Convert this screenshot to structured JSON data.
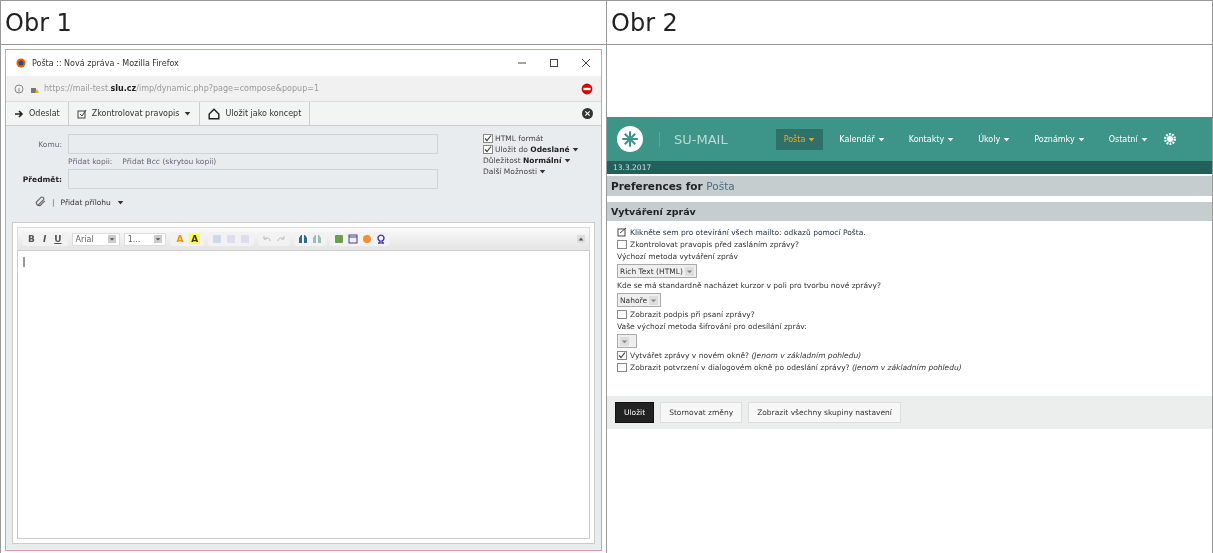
{
  "table": {
    "columns": [
      "Obr 1",
      "Obr 2"
    ]
  },
  "figure_1": {
    "window": {
      "title": "Pošta :: Nová zpráva - Mozilla Firefox",
      "url": "https://mail-test.**slu.cz**/imp/dynamic.php?page=compose&popup=1"
    },
    "toolbar": [
      {
        "label": "Odeslat",
        "kind": "send",
        "caret": false
      },
      {
        "label": "Zkontrolovat pravopis",
        "kind": "spell",
        "caret": true
      },
      {
        "label": "Uložit jako koncept",
        "kind": "draft",
        "caret": false
      }
    ],
    "fields": [
      {
        "label": "Komu:",
        "bold": false
      },
      {
        "label": "Předmět:",
        "bold": true
      }
    ],
    "cc_links": [
      "Přidat kopii:",
      "Přidat Bcc (skrytou kopii)"
    ],
    "attach": {
      "separator": "|",
      "label": "Přidat přílohu"
    },
    "options": [
      {
        "text": "HTML formát",
        "kind": "checkbox",
        "checked": true
      },
      {
        "text": "Uložit do **Odeslané**",
        "kind": "checkbox",
        "checked": true
      },
      {
        "text": "Důležitost **Normální**",
        "kind": "menu"
      },
      {
        "text": "Další Možnosti",
        "kind": "menu"
      }
    ],
    "editor": {
      "format_buttons": [
        "B",
        "I",
        "U"
      ],
      "font": "Arial",
      "size": "1...",
      "color_buttons": [
        "A",
        "A"
      ]
    }
  },
  "figure_2": {
    "brand": "SU-MAIL",
    "nav": [
      {
        "label": "Pošta",
        "selected": true
      },
      {
        "label": "Kalendář",
        "selected": false
      },
      {
        "label": "Kontakty",
        "selected": false
      },
      {
        "label": "Úkoly",
        "selected": false
      },
      {
        "label": "Poznámky",
        "selected": false
      },
      {
        "label": "Ostatní",
        "selected": false
      }
    ],
    "date": "13.3.2017",
    "heading": {
      "title": "Preferences for",
      "app": "Pošta"
    },
    "section": "Vytváření zpráv",
    "items": [
      {
        "kind": "link",
        "text": "Klikněte sem pro otevírání všech mailto: odkazů pomocí Pošta."
      },
      {
        "kind": "checkbox",
        "text": "Zkontrolovat pravopis před zasláním zprávy?",
        "checked": false
      },
      {
        "kind": "label",
        "text": "Výchozí metoda vytváření zpráv"
      },
      {
        "kind": "select",
        "value": "Rich Text (HTML)"
      },
      {
        "kind": "label",
        "text": "Kde se má standardně nacházet kurzor v poli pro tvorbu nové zprávy?"
      },
      {
        "kind": "select",
        "value": "Nahoře"
      },
      {
        "kind": "checkbox",
        "text": "Zobrazit podpis při psaní zprávy?",
        "checked": false
      },
      {
        "kind": "label",
        "text": "Vaše výchozí metoda šifrování pro odesílání zpráv:"
      },
      {
        "kind": "select"
      },
      {
        "kind": "checkbox",
        "text": "Vytvářet zprávy v novém okně? *(Jenom v základním pohledu)*",
        "checked": true
      },
      {
        "kind": "checkbox",
        "text": "Zobrazit potvrzení v dialogovém okně po odeslání zprávy? *(Jenom v základním pohledu)*",
        "checked": false
      }
    ],
    "buttons": [
      {
        "label": "Uložit",
        "kind": "primary"
      },
      {
        "label": "Stornovat změny",
        "kind": "secondary"
      },
      {
        "label": "Zobrazit všechny skupiny nastavení",
        "kind": "secondary"
      }
    ]
  }
}
